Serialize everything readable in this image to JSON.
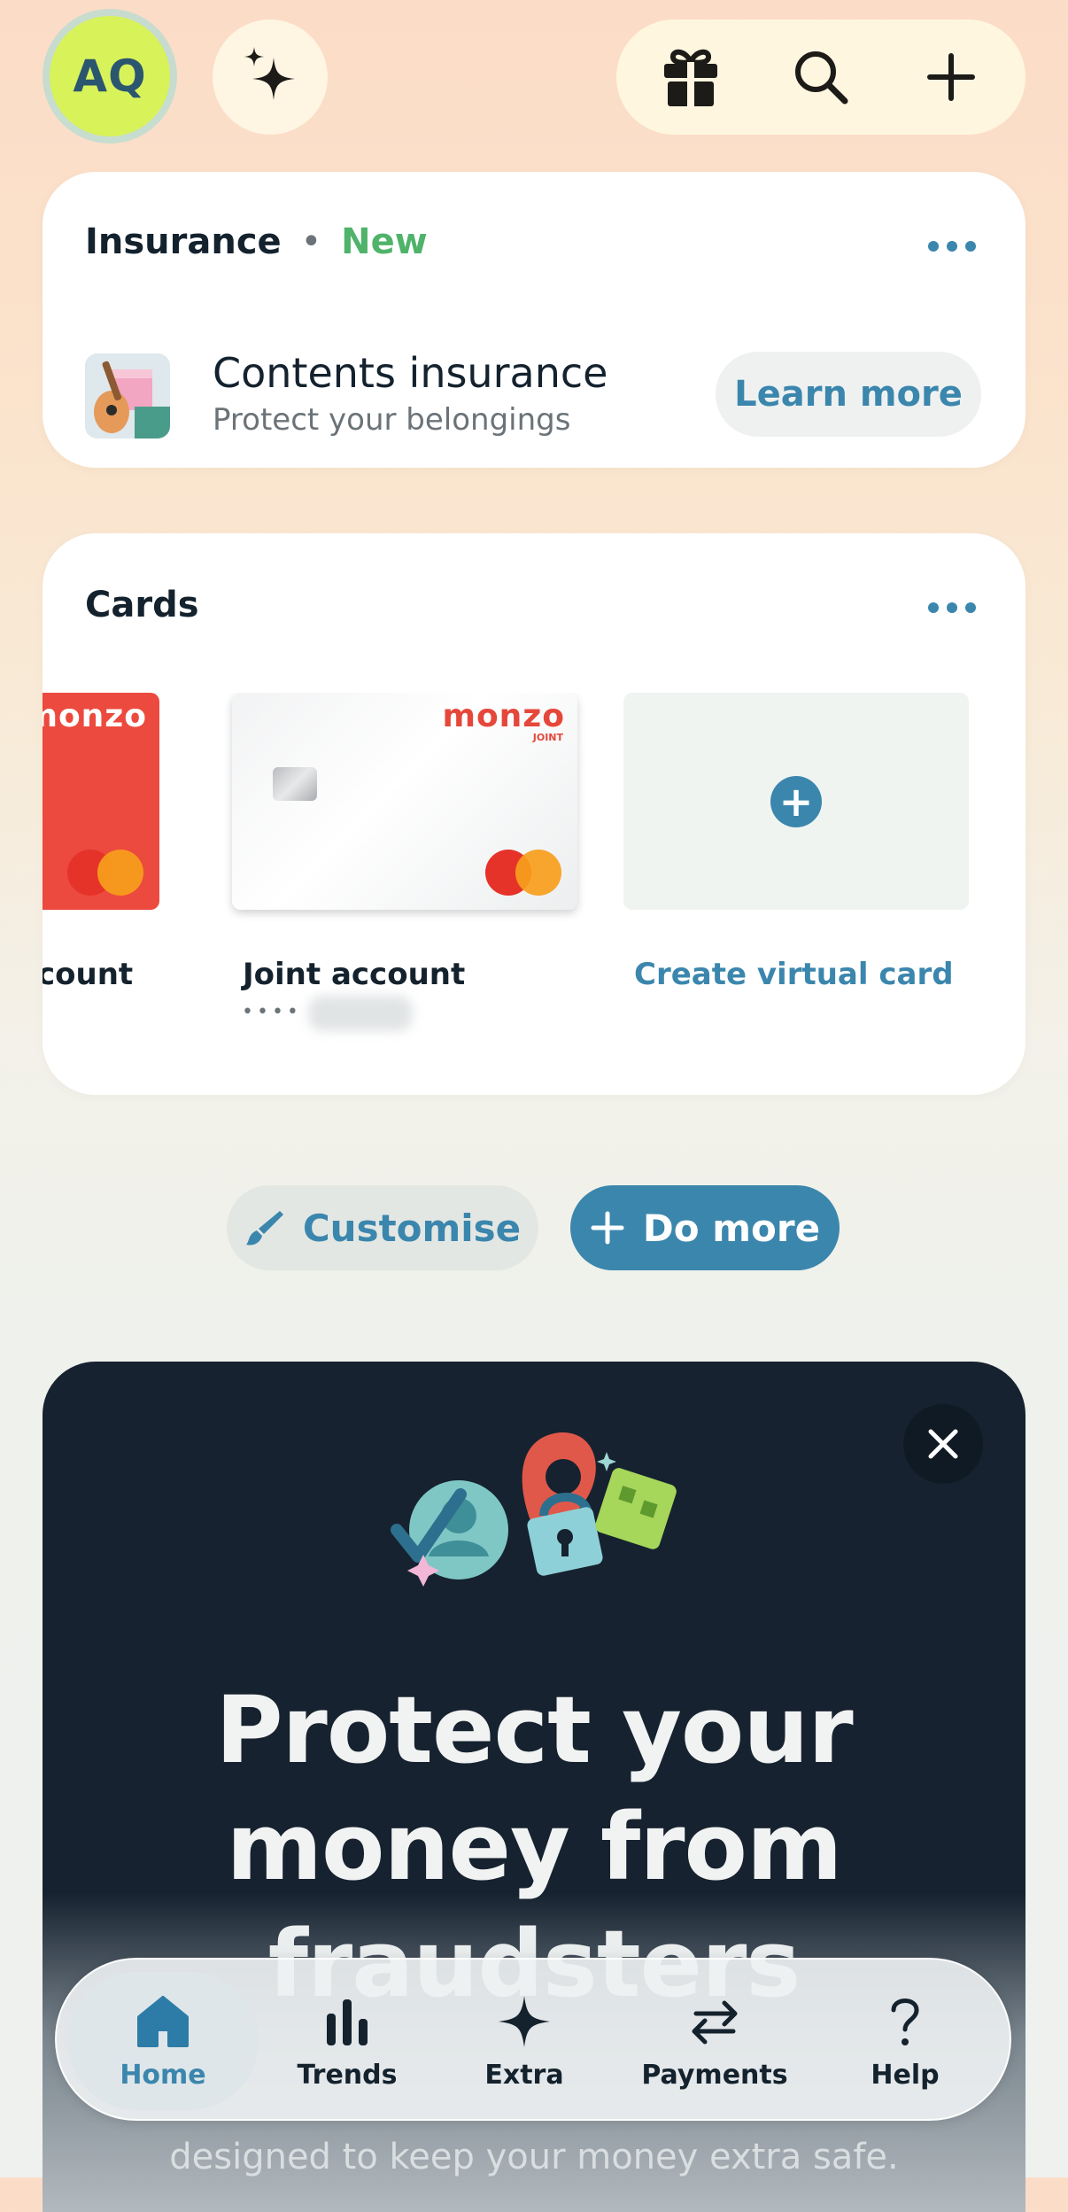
{
  "header": {
    "avatar_initials": "AQ"
  },
  "insurance": {
    "title": "Insurance",
    "separator": "•",
    "badge": "New",
    "item_title": "Contents insurance",
    "item_subtitle": "Protect your belongings",
    "cta": "Learn more"
  },
  "cards": {
    "title": "Cards",
    "items": [
      {
        "brand": "monzo",
        "label": "count"
      },
      {
        "brand": "monzo",
        "sub_brand": "JOINT",
        "label": "Joint account",
        "masked_number": "••••"
      },
      {
        "label": "Create virtual card"
      }
    ]
  },
  "actions": {
    "customise": "Customise",
    "do_more": "Do more"
  },
  "promo": {
    "title": "Protect your money from fraudsters",
    "body": "designed to keep your money extra safe."
  },
  "tabs": [
    {
      "label": "Home",
      "active": true
    },
    {
      "label": "Trends",
      "active": false
    },
    {
      "label": "Extra",
      "active": false
    },
    {
      "label": "Payments",
      "active": false
    },
    {
      "label": "Help",
      "active": false
    }
  ],
  "colors": {
    "accent": "#3b86ad",
    "new_badge": "#4fb36a",
    "avatar": "#d8f25a",
    "promo_bg": "#16222f"
  }
}
